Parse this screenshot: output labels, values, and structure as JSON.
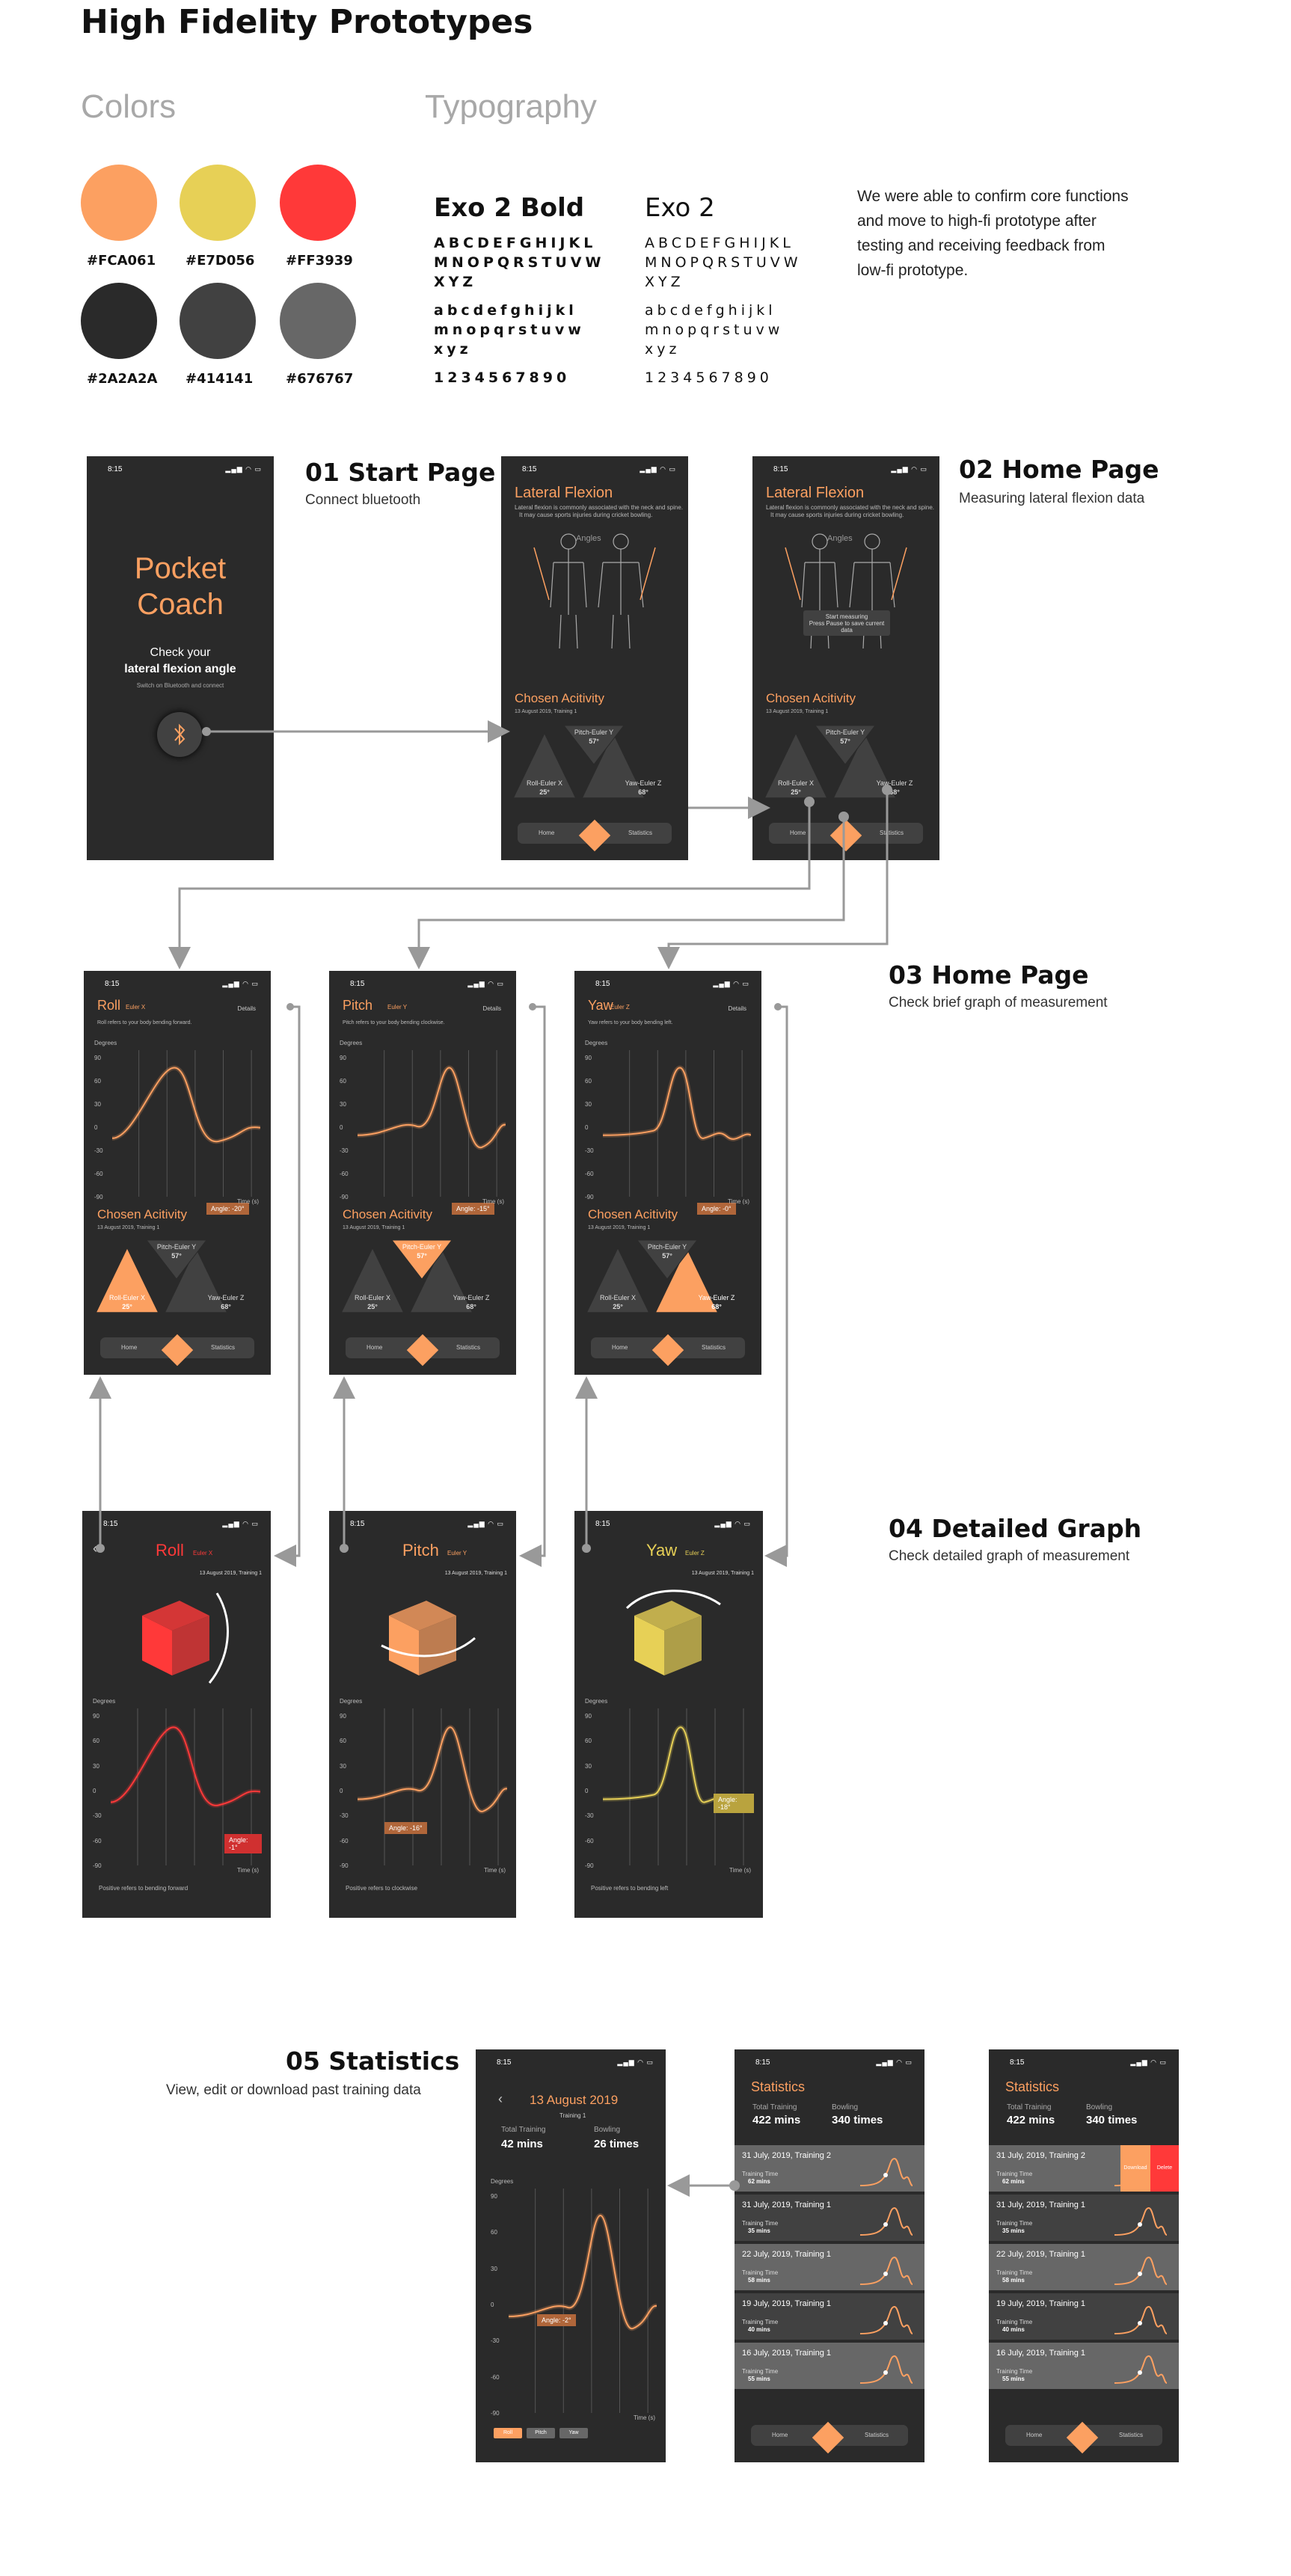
{
  "page_title": "High Fidelity Prototypes",
  "colors": {
    "heading": "Colors",
    "swatches": [
      {
        "hex": "#FCA061",
        "label": "#FCA061"
      },
      {
        "hex": "#E7D056",
        "label": "#E7D056"
      },
      {
        "hex": "#FF3939",
        "label": "#FF3939"
      },
      {
        "hex": "#2A2A2A",
        "label": "#2A2A2A"
      },
      {
        "hex": "#414141",
        "label": "#414141"
      },
      {
        "hex": "#676767",
        "label": "#676767"
      }
    ]
  },
  "typography": {
    "heading": "Typography",
    "bold": {
      "name": "Exo 2 Bold",
      "upper1": "ABCDEFGHIJKL",
      "upper2": "MNOPQRSTUVW",
      "upper3": "XYZ",
      "lower1": "abcdefghijkl",
      "lower2": "mnopqrstuvw",
      "lower3": "xyz",
      "digits": "1234567890"
    },
    "regular": {
      "name": "Exo 2",
      "upper1": "ABCDEFGHIJKL",
      "upper2": "MNOPQRSTUVW",
      "upper3": "XYZ",
      "lower1": "abcdefghijkl",
      "lower2": "mnopqrstuvw",
      "lower3": "xyz",
      "digits": "1234567890"
    },
    "description_1": "We were able to confirm core functions",
    "description_2": "and move to high-fi prototype after",
    "description_3": "testing and receiving feedback from",
    "description_4": "low-fi prototype."
  },
  "steps": {
    "s01": {
      "title": "01 Start Page",
      "subtitle": "Connect bluetooth"
    },
    "s02": {
      "title": "02 Home Page",
      "subtitle": "Measuring lateral flexion data"
    },
    "s03": {
      "title": "03 Home Page",
      "subtitle": "Check brief graph of measurement"
    },
    "s04": {
      "title": "04 Detailed Graph",
      "subtitle": "Check detailed graph of measurement"
    },
    "s05": {
      "title": "05 Statistics",
      "subtitle": "View, edit or download past training data"
    }
  },
  "status": {
    "time": "8:15",
    "icons": "▂▄▆ ◠ ▭"
  },
  "start": {
    "app_name_1": "Pocket",
    "app_name_2": "Coach",
    "check": "Check your",
    "angle": "lateral flexion angle",
    "hint": "Switch on Bluetooth and connect",
    "bt_icon": "bluetooth-icon"
  },
  "home": {
    "title": "Lateral Flexion",
    "desc_1": "Lateral flexion is commonly associated with the neck and spine.",
    "desc_2": "It may cause sports injuries during cricket bowling.",
    "angles": "Angles",
    "activity": "Chosen Acitivity",
    "activity_date": "13 August 2019, Training 1",
    "pitch": "Pitch-Euler Y",
    "pitch_v": "57°",
    "roll": "Roll-Euler X",
    "roll_v": "25°",
    "yaw": "Yaw-Euler Z",
    "yaw_v": "68°",
    "nav_home": "Home",
    "nav_stats": "Statistics",
    "tooltip_1": "Start measuring",
    "tooltip_2": "Press Pause to save current data"
  },
  "brief": {
    "roll": {
      "name": "Roll",
      "sub": "Euler X",
      "desc": "Roll refers to your body bending forward.",
      "angle": "Angle: -20°"
    },
    "pitch": {
      "name": "Pitch",
      "sub": "Euler Y",
      "desc": "Pitch refers to your body bending clockwise.",
      "angle": "Angle: -15°"
    },
    "yaw": {
      "name": "Yaw",
      "sub": "Euler Z",
      "desc": "Yaw refers to your body bending left.",
      "angle": "Angle: -0°"
    },
    "details": "Details",
    "degrees": "Degrees",
    "time": "Time (s)",
    "ticks": [
      "90",
      "60",
      "30",
      "0",
      "-30",
      "-60",
      "-90"
    ]
  },
  "detail": {
    "roll": {
      "name": "Roll",
      "sub": "Euler X",
      "angle": "Angle: -1°",
      "note": "Positive refers to bending forward"
    },
    "pitch": {
      "name": "Pitch",
      "sub": "Euler Y",
      "angle": "Angle: -16°",
      "note": "Positive refers to clockwise"
    },
    "yaw": {
      "name": "Yaw",
      "sub": "Euler Z",
      "angle": "Angle: -18°",
      "note": "Positive refers to bending left"
    },
    "date": "13 August 2019, Training 1"
  },
  "stats_detail": {
    "title": "13 August 2019",
    "sub": "Training 1",
    "total_lbl": "Total Training",
    "total_v": "42 mins",
    "bowl_lbl": "Bowling",
    "bowl_v": "26 times",
    "angle": "Angle: -2°",
    "tab_roll": "Roll",
    "tab_pitch": "Pitch",
    "tab_yaw": "Yaw"
  },
  "stats": {
    "title": "Statistics",
    "total_lbl": "Total Training",
    "total_v": "422 mins",
    "bowl_lbl": "Bowling",
    "bowl_v": "340 times",
    "tt_lbl": "Training Time",
    "rows": [
      {
        "date": "31 July, 2019, Training 2",
        "time": "62 mins"
      },
      {
        "date": "31 July, 2019, Training 1",
        "time": "35 mins"
      },
      {
        "date": "22 July, 2019, Training 1",
        "time": "58 mins"
      },
      {
        "date": "19 July, 2019, Training 1",
        "time": "40 mins"
      },
      {
        "date": "16 July, 2019, Training 1",
        "time": "55 mins"
      }
    ],
    "download": "Download",
    "delete": "Delete"
  }
}
